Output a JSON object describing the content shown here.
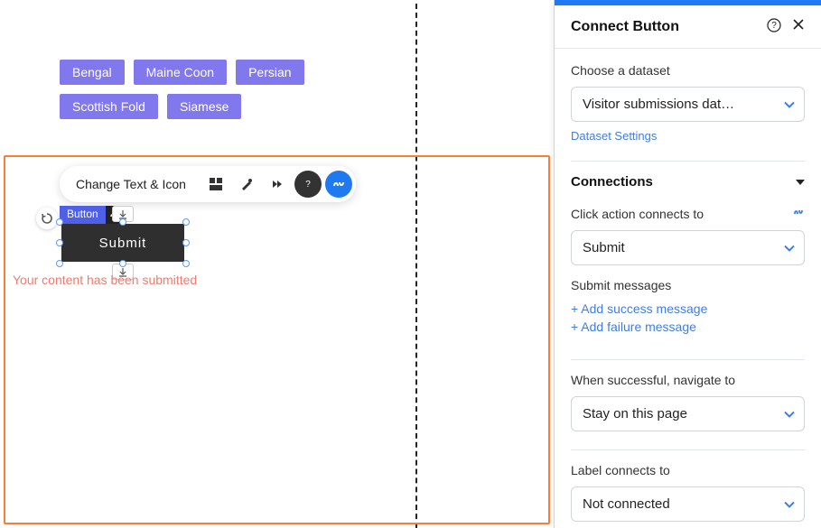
{
  "tags": [
    "Bengal",
    "Maine Coon",
    "Persian",
    "Scottish Fold",
    "Siamese"
  ],
  "toolbar": {
    "change_text_label": "Change Text & Icon"
  },
  "canvas": {
    "element_type_label": "Button",
    "button_text": "Submit",
    "status_message": "Your content has been submitted"
  },
  "panel": {
    "title": "Connect Button",
    "dataset": {
      "label": "Choose a dataset",
      "value": "Visitor submissions dat…",
      "settings_link": "Dataset Settings"
    },
    "connections": {
      "heading": "Connections",
      "click_action": {
        "label": "Click action connects to",
        "value": "Submit"
      },
      "submit_messages": {
        "label": "Submit messages",
        "add_success": "+ Add success message",
        "add_failure": "+ Add failure message"
      },
      "navigate": {
        "label": "When successful, navigate to",
        "value": "Stay on this page"
      },
      "label_connect": {
        "label": "Label connects to",
        "value": "Not connected"
      }
    }
  }
}
